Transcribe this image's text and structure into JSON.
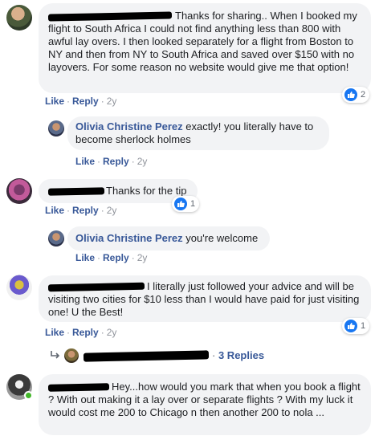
{
  "comments": [
    {
      "text": "Thanks for sharing.. When I booked my flight to South Africa I could not find anything less than 800 with awful lay overs. I then looked separately for a flight from Boston to NY and then from NY to South Africa and saved over $150 with no layovers. For some reason no website would give me that option!",
      "like": "Like",
      "reply": "Reply",
      "time": "2y",
      "reactions": "2"
    },
    {
      "author": "Olivia Christine Perez",
      "text": "exactly! you literally have to become sherlock holmes",
      "like": "Like",
      "reply": "Reply",
      "time": "2y"
    },
    {
      "text": "Thanks for the tip",
      "like": "Like",
      "reply": "Reply",
      "time": "2y",
      "reactions": "1"
    },
    {
      "author": "Olivia Christine Perez",
      "text": "you're welcome",
      "like": "Like",
      "reply": "Reply",
      "time": "2y"
    },
    {
      "text": "I literally just followed your advice and will be visiting two cities for $10 less than I would have paid for just visiting one! U the Best!",
      "like": "Like",
      "reply": "Reply",
      "time": "2y",
      "reactions": "1",
      "replies_summary": "3 Replies",
      "replies_separator": "·"
    },
    {
      "text": "Hey...how would you mark that when you book a flight ? With out making it a lay over or separate flights ? With my luck it would cost me 200 to Chicago n then another 200 to nola ..."
    }
  ],
  "separator": "·",
  "colors": {
    "link": "#385898",
    "bubble": "#f2f3f5",
    "like_blue": "#1877f2",
    "online": "#42b72a"
  }
}
